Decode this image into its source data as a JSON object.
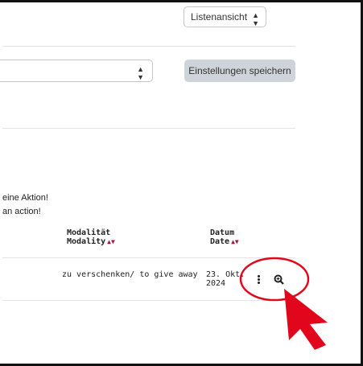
{
  "header": {
    "view_select_value": "Listenansicht"
  },
  "toolbar": {
    "save_label": "Einstellungen speichern"
  },
  "notice": {
    "line_de": "eine Aktion!",
    "line_en": "an action!"
  },
  "table": {
    "columns": [
      {
        "label_de": "Modalität",
        "label_en": "Modality",
        "sort": "▲▼"
      },
      {
        "label_de": "Datum",
        "label_en": "Date",
        "sort": "▲▼"
      }
    ],
    "rows": [
      {
        "modality": "zu verschenken/ to give away",
        "date_line1": "23. Okt.",
        "date_line2": "2024"
      }
    ]
  },
  "icons": {
    "kebab": "more-vertical-icon",
    "details": "zoom-in-icon"
  },
  "colors": {
    "sort_arrow": "#a0143c",
    "annotation": "#e1061b",
    "button_bg": "#ced4da"
  }
}
